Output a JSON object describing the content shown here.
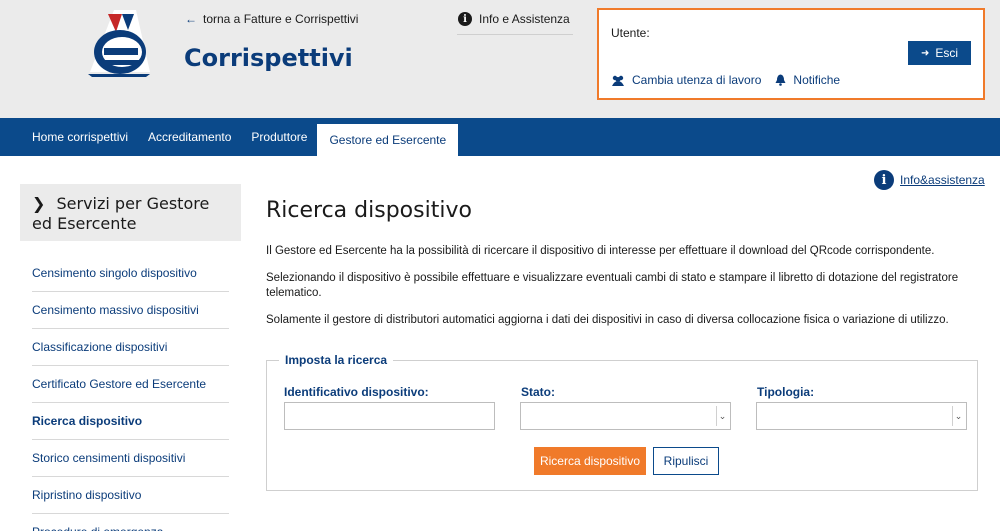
{
  "header": {
    "app_title": "Corrispettivi",
    "back_link": "torna a Fatture e Corrispettivi",
    "info_link": "Info e Assistenza",
    "user_label": "Utente:",
    "logout_label": "Esci",
    "change_user_label": "Cambia utenza di lavoro",
    "notifications_label": "Notifiche"
  },
  "nav": {
    "items": [
      {
        "label": "Home corrispettivi"
      },
      {
        "label": "Accreditamento"
      },
      {
        "label": "Produttore"
      },
      {
        "label": "Gestore ed Esercente"
      }
    ]
  },
  "sidebar": {
    "heading": "Servizi per Gestore ed Esercente",
    "items": [
      {
        "label": "Censimento singolo dispositivo"
      },
      {
        "label": "Censimento massivo dispositivi"
      },
      {
        "label": "Classificazione dispositivi"
      },
      {
        "label": "Certificato Gestore ed Esercente"
      },
      {
        "label": "Ricerca dispositivo"
      },
      {
        "label": "Storico censimenti dispositivi"
      },
      {
        "label": "Ripristino dispositivo"
      },
      {
        "label": "Procedure di emergenza"
      }
    ]
  },
  "main": {
    "help_link": "Info&assistenza",
    "title": "Ricerca dispositivo",
    "paragraphs": [
      "Il Gestore ed Esercente ha la possibilità di ricercare il dispositivo di interesse per effettuare il download del QRcode corrispondente.",
      "Selezionando il dispositivo è possibile effettuare e visualizzare eventuali cambi di stato e stampare il libretto di dotazione del registratore telematico.",
      "Solamente il gestore di distributori automatici aggiorna i dati dei dispositivi in caso di diversa collocazione fisica o variazione di utilizzo."
    ],
    "search": {
      "legend": "Imposta la ricerca",
      "id_label": "Identificativo dispositivo:",
      "id_value": "",
      "status_label": "Stato:",
      "status_value": "",
      "type_label": "Tipologia:",
      "type_value": "",
      "search_button": "Ricerca dispositivo",
      "clear_button": "Ripulisci"
    }
  },
  "colors": {
    "brand_blue": "#0b4a8b",
    "accent_orange": "#f07a2a",
    "header_gray": "#ebebeb"
  }
}
